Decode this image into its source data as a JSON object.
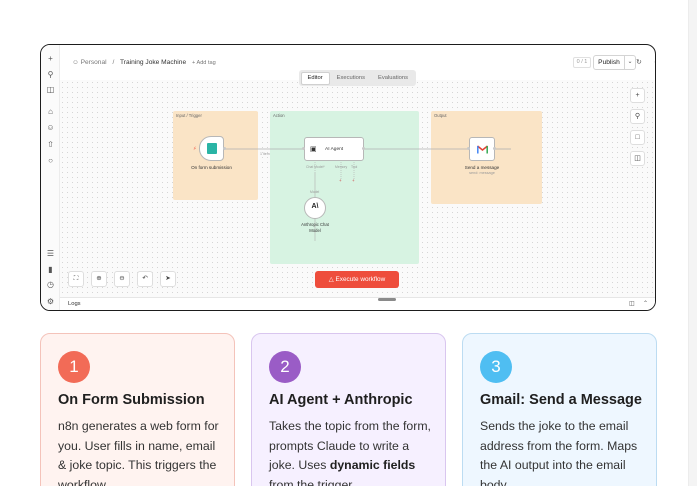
{
  "breadcrumb": {
    "owner": "Personal",
    "separator": "/",
    "workflow_name": "Training Joke Machine",
    "add_tag": "+ Add tag"
  },
  "toolbar": {
    "version": "0 / 1",
    "publish_label": "Publish"
  },
  "tabs": [
    {
      "label": "Editor",
      "active": true
    },
    {
      "label": "Executions",
      "active": false
    },
    {
      "label": "Evaluations",
      "active": false
    }
  ],
  "stickies": {
    "input": "Input / Trigger",
    "action": "Action",
    "output": "Output"
  },
  "nodes": {
    "trigger": {
      "label": "On form submission"
    },
    "agent": {
      "label": "AI Agent",
      "port_chat": "Chat Model*",
      "port_memory": "Memory",
      "port_tool": "Tool"
    },
    "model": {
      "label_line1": "Anthropic Chat",
      "label_line2": "Model",
      "port_label": "Model"
    },
    "gmail": {
      "label": "Send a message",
      "sub": "send: message"
    },
    "edge_label": "1 item"
  },
  "execute_label": "Execute workflow",
  "logs_label": "Logs",
  "colors": {
    "sticky_input": "#fae4c6",
    "sticky_action": "#d7f3e2",
    "sticky_output": "#fae4c6",
    "execute": "#ee4d3c",
    "trigger_icon": "#2ab4a5",
    "card1_bg": "#fff3f0",
    "card1_accent": "#f26b57",
    "card2_bg": "#f6f0ff",
    "card2_accent": "#9a5cc6",
    "card3_bg": "#eef7ff",
    "card3_accent": "#4fbef2"
  },
  "cards": [
    {
      "number": "1",
      "title": "On Form Submission",
      "body_pre": "n8n generates a web form for you. User fills in name, email & joke topic. This triggers the workflow.",
      "body_bold": "",
      "body_post": ""
    },
    {
      "number": "2",
      "title": "AI Agent + Anthropic",
      "body_pre": "Takes the topic from the form, prompts Claude to write a joke. Uses ",
      "body_bold": "dynamic fields",
      "body_post": " from the trigger."
    },
    {
      "number": "3",
      "title": "Gmail: Send a Message",
      "body_pre": "Sends the joke to the email address from the form. Maps the AI output into the email body.",
      "body_bold": "",
      "body_post": ""
    }
  ]
}
